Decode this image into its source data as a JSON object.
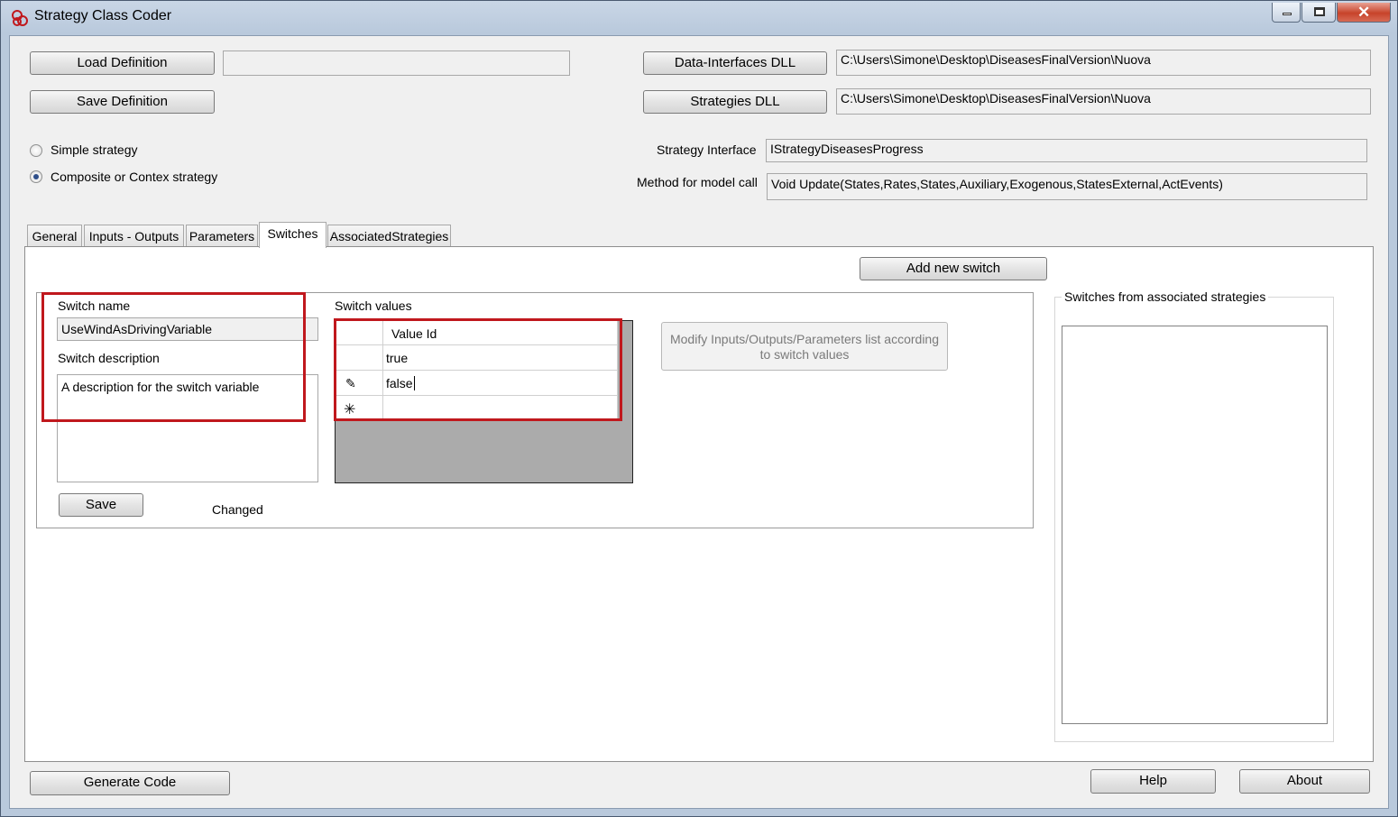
{
  "window": {
    "title": "Strategy Class Coder",
    "accent_red": "#c0181d"
  },
  "toolbar": {
    "load_definition": "Load Definition",
    "save_definition": "Save Definition",
    "definition_path": "",
    "data_interfaces_dll": "Data-Interfaces DLL",
    "data_interfaces_path": "C:\\Users\\Simone\\Desktop\\DiseasesFinalVersion\\Nuova",
    "strategies_dll": "Strategies DLL",
    "strategies_path": "C:\\Users\\Simone\\Desktop\\DiseasesFinalVersion\\Nuova"
  },
  "strategy_type": {
    "simple": "Simple strategy",
    "composite": "Composite or Contex strategy",
    "selected": "composite"
  },
  "interface": {
    "strategy_interface_label": "Strategy Interface",
    "strategy_interface_value": "IStrategyDiseasesProgress",
    "method_label": "Method for model call",
    "method_value": "Void Update(States,Rates,States,Auxiliary,Exogenous,StatesExternal,ActEvents)"
  },
  "tabs": [
    {
      "label": "General"
    },
    {
      "label": "Inputs - Outputs"
    },
    {
      "label": "Parameters"
    },
    {
      "label": "Switches",
      "active": true
    },
    {
      "label": "AssociatedStrategies"
    }
  ],
  "switches": {
    "add_new_switch": "Add new switch",
    "switch_name_label": "Switch name",
    "switch_name_value": "UseWindAsDrivingVariable",
    "switch_description_label": "Switch description",
    "switch_description_value": "A description for the switch variable",
    "save_label": "Save",
    "status": "Changed",
    "switch_values_label": "Switch values",
    "grid": {
      "column_header": "Value Id",
      "rows": [
        "true",
        "false",
        ""
      ]
    },
    "modify_button": "Modify Inputs/Outputs/Parameters list  according to switch values",
    "associated_label": "Switches from associated strategies"
  },
  "footer": {
    "generate_code": "Generate Code",
    "help": "Help",
    "about": "About"
  }
}
